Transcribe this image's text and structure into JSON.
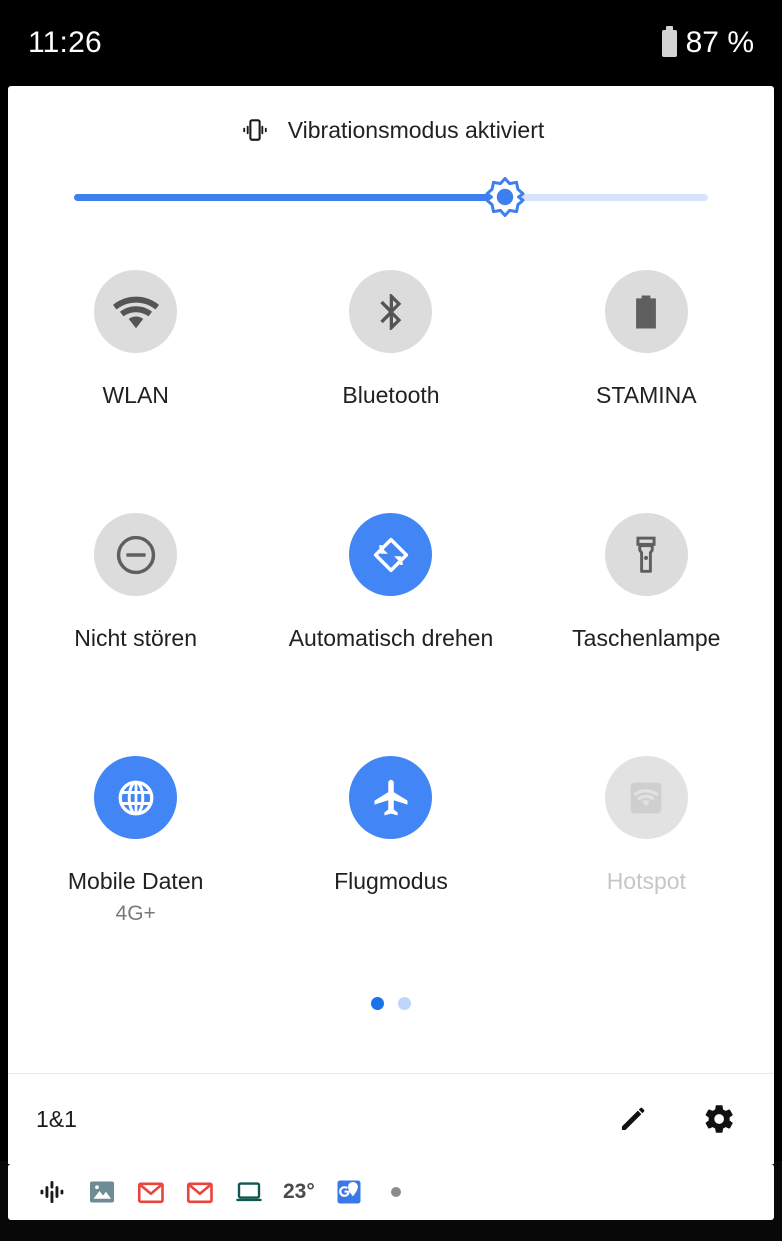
{
  "status_bar": {
    "clock": "11:26",
    "battery_percent": "87 %",
    "battery_icon": "battery-icon"
  },
  "quick_settings": {
    "header": {
      "icon": "vibration-icon",
      "text": "Vibrationsmodus aktiviert"
    },
    "brightness": {
      "icon": "brightness-icon",
      "value_percent": 68
    },
    "tiles": [
      {
        "label": "WLAN",
        "sub": "",
        "icon": "wifi-icon",
        "state": "off"
      },
      {
        "label": "Bluetooth",
        "sub": "",
        "icon": "bluetooth-icon",
        "state": "off"
      },
      {
        "label": "STAMINA",
        "sub": "",
        "icon": "battery-icon",
        "state": "off"
      },
      {
        "label": "Nicht stören",
        "sub": "",
        "icon": "do-not-disturb-icon",
        "state": "off"
      },
      {
        "label": "Automatisch drehen",
        "sub": "",
        "icon": "auto-rotate-icon",
        "state": "on"
      },
      {
        "label": "Taschenlampe",
        "sub": "",
        "icon": "flashlight-icon",
        "state": "off"
      },
      {
        "label": "Mobile Daten",
        "sub": "4G+",
        "icon": "globe-icon",
        "state": "on"
      },
      {
        "label": "Flugmodus",
        "sub": "",
        "icon": "airplane-icon",
        "state": "on"
      },
      {
        "label": "Hotspot",
        "sub": "",
        "icon": "hotspot-icon",
        "state": "disabled"
      }
    ],
    "pages": {
      "count": 2,
      "active_index": 0
    },
    "footer": {
      "carrier": "1&1",
      "edit_icon": "pencil-icon",
      "settings_icon": "gear-icon"
    }
  },
  "notification_strip": {
    "items": [
      {
        "icon": "google-podcasts-icon",
        "label": ""
      },
      {
        "icon": "photos-image-icon",
        "label": ""
      },
      {
        "icon": "gmail-icon",
        "label": ""
      },
      {
        "icon": "gmail-icon",
        "label": ""
      },
      {
        "icon": "laptop-icon",
        "label": ""
      },
      {
        "icon": "temperature-text",
        "label": "23°"
      },
      {
        "icon": "google-maps-icon",
        "label": ""
      },
      {
        "icon": "overflow-dot-icon",
        "label": ""
      }
    ]
  },
  "colors": {
    "accent_blue": "#4285f4",
    "slider_blue": "#3d7fef",
    "slider_track": "#d5e3fd",
    "tile_off": "#dcdcdc",
    "tile_disabled": "#e2e2e2",
    "icon_gray": "#555555",
    "text_primary": "#202124",
    "text_dim": "#c6c6c6",
    "background": "#000000",
    "panel": "#ffffff"
  }
}
